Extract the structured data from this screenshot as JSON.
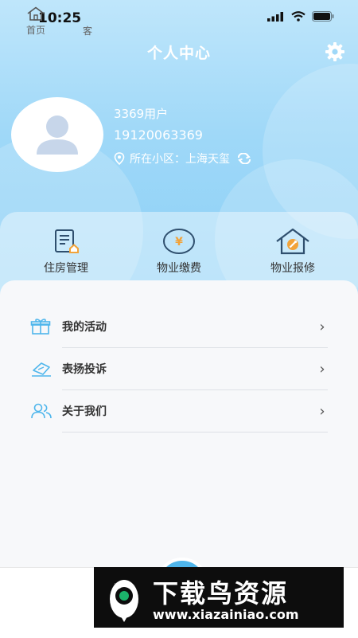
{
  "status_bar": {
    "time": "10:25"
  },
  "header": {
    "title": "个人中心"
  },
  "user": {
    "name": "3369用户",
    "phone": "19120063369",
    "community_label": "所在小区：上海天玺"
  },
  "quick_actions": [
    {
      "label": "住房管理",
      "icon": "house-document-icon"
    },
    {
      "label": "物业缴费",
      "icon": "yuan-coin-icon",
      "symbol": "¥"
    },
    {
      "label": "物业报修",
      "icon": "house-wrench-icon"
    }
  ],
  "menu": [
    {
      "label": "我的活动",
      "icon": "gift-icon"
    },
    {
      "label": "表扬投诉",
      "icon": "feedback-icon"
    },
    {
      "label": "关于我们",
      "icon": "users-icon"
    }
  ],
  "tabbar": {
    "home": "首页",
    "service_partial": "客"
  },
  "watermark": {
    "brand": "下载鸟资源",
    "url": "www.xiazainiao.com"
  },
  "colors": {
    "primary": "#4fb6ec",
    "hero_top": "#bfe6fb",
    "hero_bottom": "#8bd0f6",
    "accent_orange": "#f2a33a"
  }
}
